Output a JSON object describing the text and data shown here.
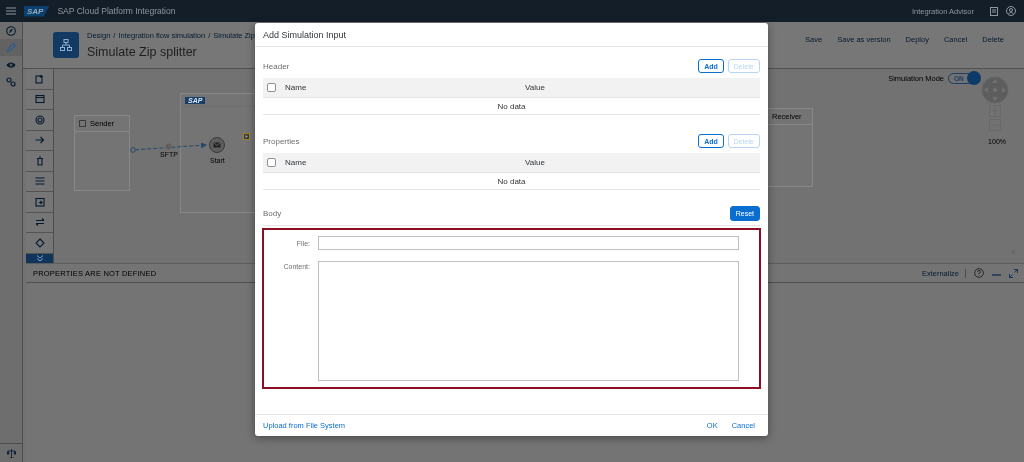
{
  "shell_bar": {
    "logo": "SAP",
    "title": "SAP Cloud Platform Integration",
    "right_link": "Integration Advisor"
  },
  "side_nav": {
    "items": [
      {
        "selected": false
      },
      {
        "selected": true
      },
      {
        "selected": false
      },
      {
        "selected": false
      }
    ]
  },
  "page_header": {
    "breadcrumb": [
      "Design",
      "Integration flow simulation",
      "Simulate Zip"
    ],
    "separator": "/",
    "title": "Simulate Zip splitter",
    "actions": [
      "Save",
      "Save as version",
      "Deploy",
      "Cancel",
      "Delete"
    ]
  },
  "canvas": {
    "sender": "Sender",
    "receiver": "Receiver",
    "process_logo": "SAP",
    "adapter": "SFTP",
    "start": "Start",
    "simulation_mode": {
      "label": "Simulation Mode",
      "state_text": "ON",
      "on": true
    },
    "zoom": "100%"
  },
  "properties_panel": {
    "message": "PROPERTIES ARE NOT DEFINED",
    "externalize": "Externalize"
  },
  "dialog": {
    "title": "Add Simulation Input",
    "sections": [
      {
        "title": "Header",
        "add": "Add",
        "delete": {
          "label": "Delete",
          "disabled": true
        },
        "columns": [
          "Name",
          "Value"
        ],
        "select_all_checked": false,
        "empty_text": "No data"
      },
      {
        "title": "Properties",
        "add": "Add",
        "delete": {
          "label": "Delete",
          "disabled": true
        },
        "columns": [
          "Name",
          "Value"
        ],
        "select_all_checked": false,
        "empty_text": "No data"
      }
    ],
    "body": {
      "title": "Body",
      "reset": "Reset",
      "highlighted": true,
      "file_label": "File:",
      "content_label": "Content:"
    },
    "footer": {
      "upload": "Upload from File System",
      "ok": "OK",
      "cancel": "Cancel"
    }
  }
}
